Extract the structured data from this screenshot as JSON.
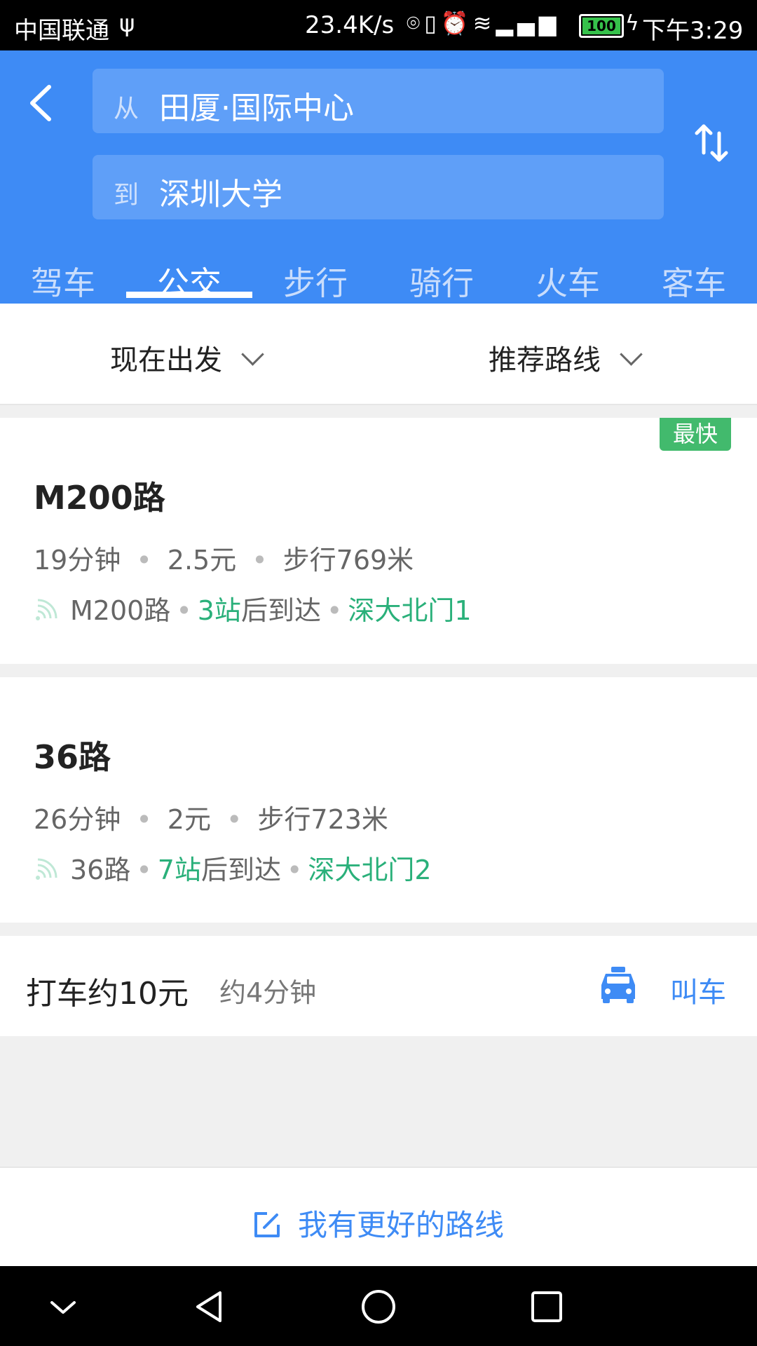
{
  "status_bar": {
    "carrier": "中国联通",
    "net_speed": "23.4K/s",
    "battery": "100",
    "time": "下午3:29"
  },
  "search": {
    "from_prefix": "从",
    "from_value": "田厦·国际中心",
    "to_prefix": "到",
    "to_value": "深圳大学"
  },
  "modes": [
    {
      "label": "驾车"
    },
    {
      "label": "公交"
    },
    {
      "label": "步行"
    },
    {
      "label": "骑行"
    },
    {
      "label": "火车"
    },
    {
      "label": "客车"
    }
  ],
  "active_mode": "公交",
  "filters": {
    "departure": "现在出发",
    "sort": "推荐路线"
  },
  "routes": [
    {
      "badge": "最快",
      "title": "M200路",
      "duration": "19分钟",
      "price": "2.5元",
      "walk": "步行769米",
      "line": "M200路",
      "stops": "3站",
      "arrive_text": "后到达",
      "station": "深大北门1"
    },
    {
      "title": "36路",
      "duration": "26分钟",
      "price": "2元",
      "walk": "步行723米",
      "line": "36路",
      "stops": "7站",
      "arrive_text": "后到达",
      "station": "深大北门2"
    }
  ],
  "taxi": {
    "price": "打车约10元",
    "time": "约4分钟",
    "action": "叫车"
  },
  "suggest": {
    "label": "我有更好的路线"
  },
  "colors": {
    "header_blue": "#3e8bf5",
    "accent_green": "#2ab07a",
    "badge_green": "#42ba6d"
  }
}
